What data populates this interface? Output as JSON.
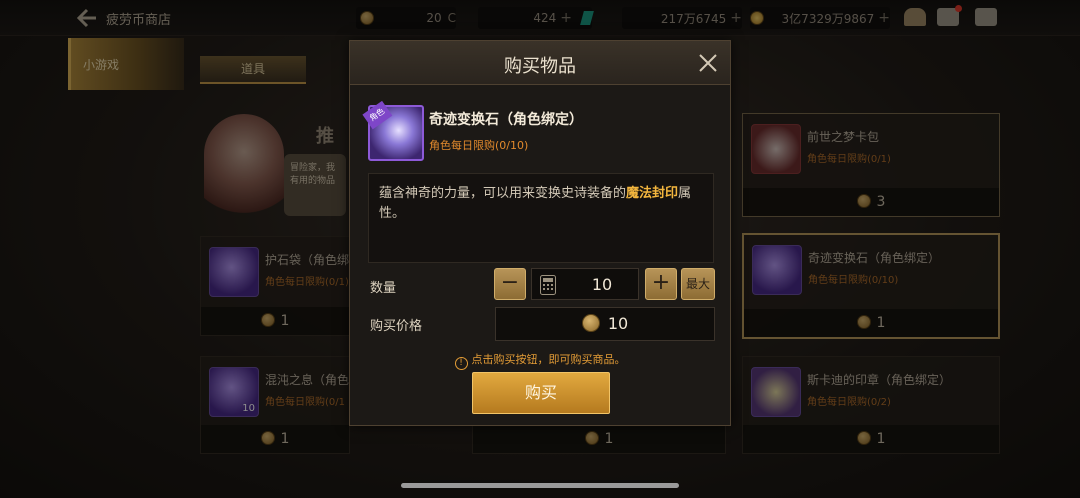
{
  "topbar": {
    "title": "疲劳币商店",
    "currencies": [
      {
        "value": "20",
        "icon": "fatigue-coin-icon"
      },
      {
        "value": "424",
        "icon": "cera-icon"
      },
      {
        "value": "217万6745",
        "icon": "gem-icon"
      },
      {
        "value": "3亿7329万9867",
        "icon": "gold-icon"
      }
    ]
  },
  "sidebar": {
    "active_tab": "小游戏"
  },
  "category_tab": "道具",
  "promo": {
    "label": "推",
    "bubble": "冒险家，我 有用的物品"
  },
  "cards": [
    {
      "name": "护石袋（角色绑",
      "limit": "角色每日限购(0/1)",
      "price": "1"
    },
    {
      "name": "混沌之息（角色",
      "limit": "角色每日限购(0/1",
      "price": "1",
      "count": "10"
    },
    {
      "name": "前世之梦卡包",
      "limit": "角色每日限购(0/1)",
      "price": "3"
    },
    {
      "name": "奇迹变换石（角色绑定）",
      "limit": "角色每日限购(0/10)",
      "price": "1"
    },
    {
      "name": "斯卡迪的印章（角色绑定）",
      "limit": "角色每日限购(0/2)",
      "price": "1"
    },
    {
      "name": "",
      "limit": "",
      "price": "1"
    }
  ],
  "dialog": {
    "title": "购买物品",
    "item": {
      "name": "奇迹变换石（角色绑定）",
      "limit": "角色每日限购(0/10)",
      "tag": "角色"
    },
    "description_pre": "蕴含神奇的力量，可以用来变换史诗装备的",
    "description_highlight": "魔法封印",
    "description_post": "属性。",
    "quantity_label": "数量",
    "quantity_value": "10",
    "max_label": "最大",
    "price_label": "购买价格",
    "price_value": "10",
    "notice": "点击购买按钮，即可购买商品。",
    "buy_label": "购买"
  }
}
